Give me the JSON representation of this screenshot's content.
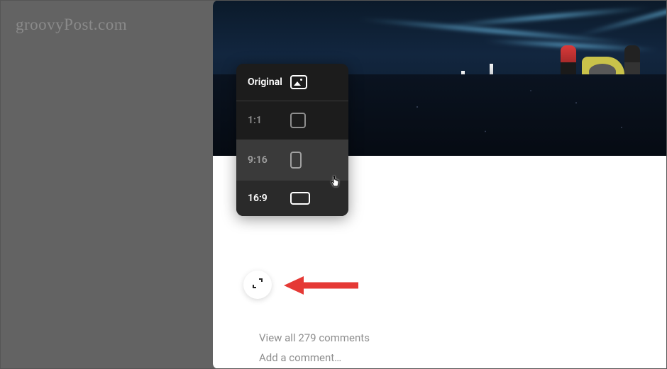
{
  "watermark": "groovyPost.com",
  "crop_menu": {
    "options": [
      {
        "label": "Original"
      },
      {
        "label": "1:1"
      },
      {
        "label": "9:16"
      },
      {
        "label": "16:9"
      }
    ]
  },
  "comments": {
    "view_all": "View all 279 comments",
    "add_placeholder": "Add a comment…"
  }
}
